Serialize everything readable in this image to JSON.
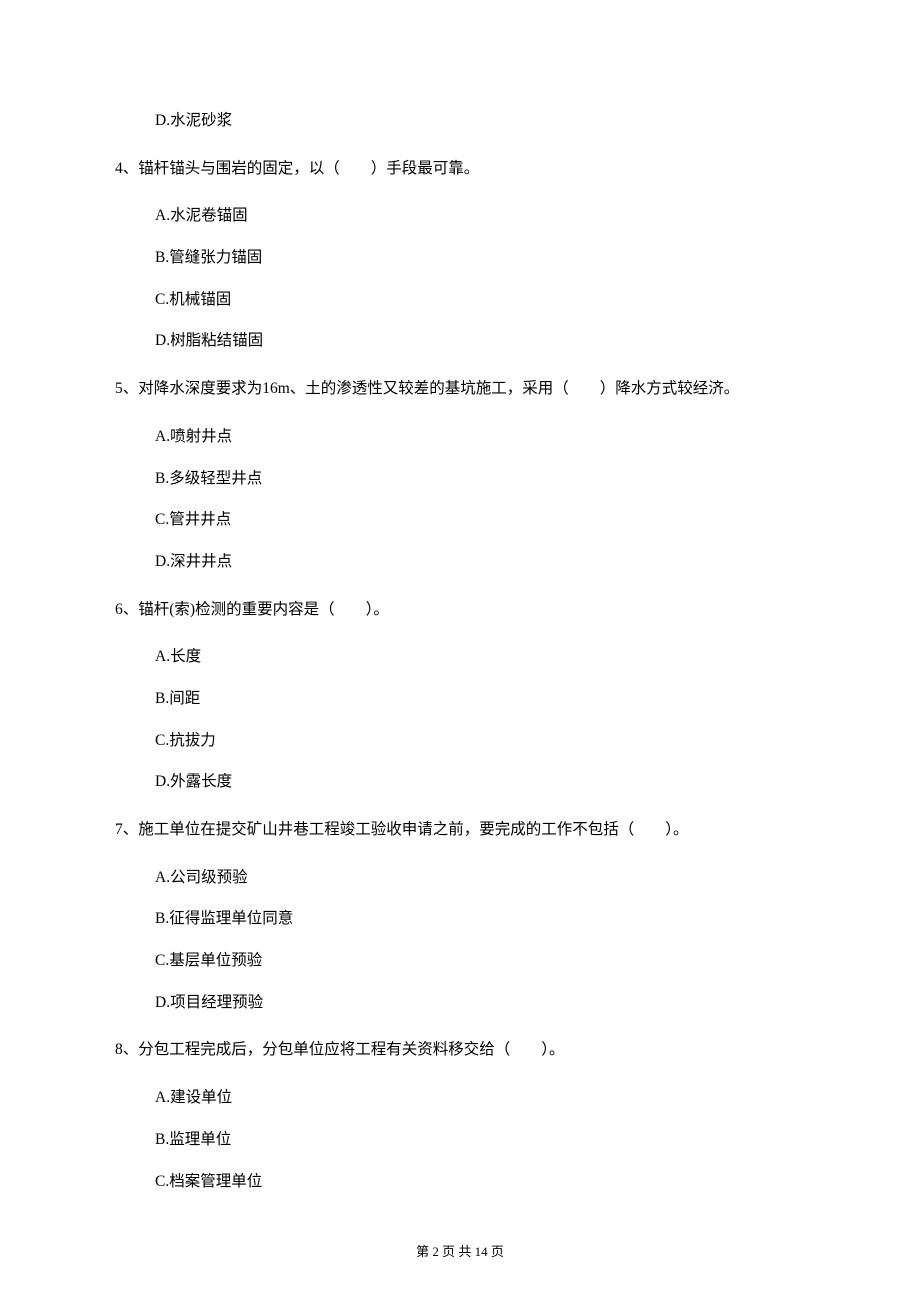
{
  "q3": {
    "optD": "D.水泥砂浆"
  },
  "q4": {
    "stem": "4、锚杆锚头与围岩的固定，以（　　）手段最可靠。",
    "optA": "A.水泥卷锚固",
    "optB": "B.管缝张力锚固",
    "optC": "C.机械锚固",
    "optD": "D.树脂粘结锚固"
  },
  "q5": {
    "stem": "5、对降水深度要求为16m、土的渗透性又较差的基坑施工，采用（　　）降水方式较经济。",
    "optA": "A.喷射井点",
    "optB": "B.多级轻型井点",
    "optC": "C.管井井点",
    "optD": "D.深井井点"
  },
  "q6": {
    "stem": "6、锚杆(索)检测的重要内容是（　　）。",
    "optA": "A.长度",
    "optB": "B.间距",
    "optC": "C.抗拔力",
    "optD": "D.外露长度"
  },
  "q7": {
    "stem": "7、施工单位在提交矿山井巷工程竣工验收申请之前，要完成的工作不包括（　　）。",
    "optA": "A.公司级预验",
    "optB": "B.征得监理单位同意",
    "optC": "C.基层单位预验",
    "optD": "D.项目经理预验"
  },
  "q8": {
    "stem": "8、分包工程完成后，分包单位应将工程有关资料移交给（　　）。",
    "optA": "A.建设单位",
    "optB": "B.监理单位",
    "optC": "C.档案管理单位"
  },
  "footer": "第 2 页 共 14 页"
}
